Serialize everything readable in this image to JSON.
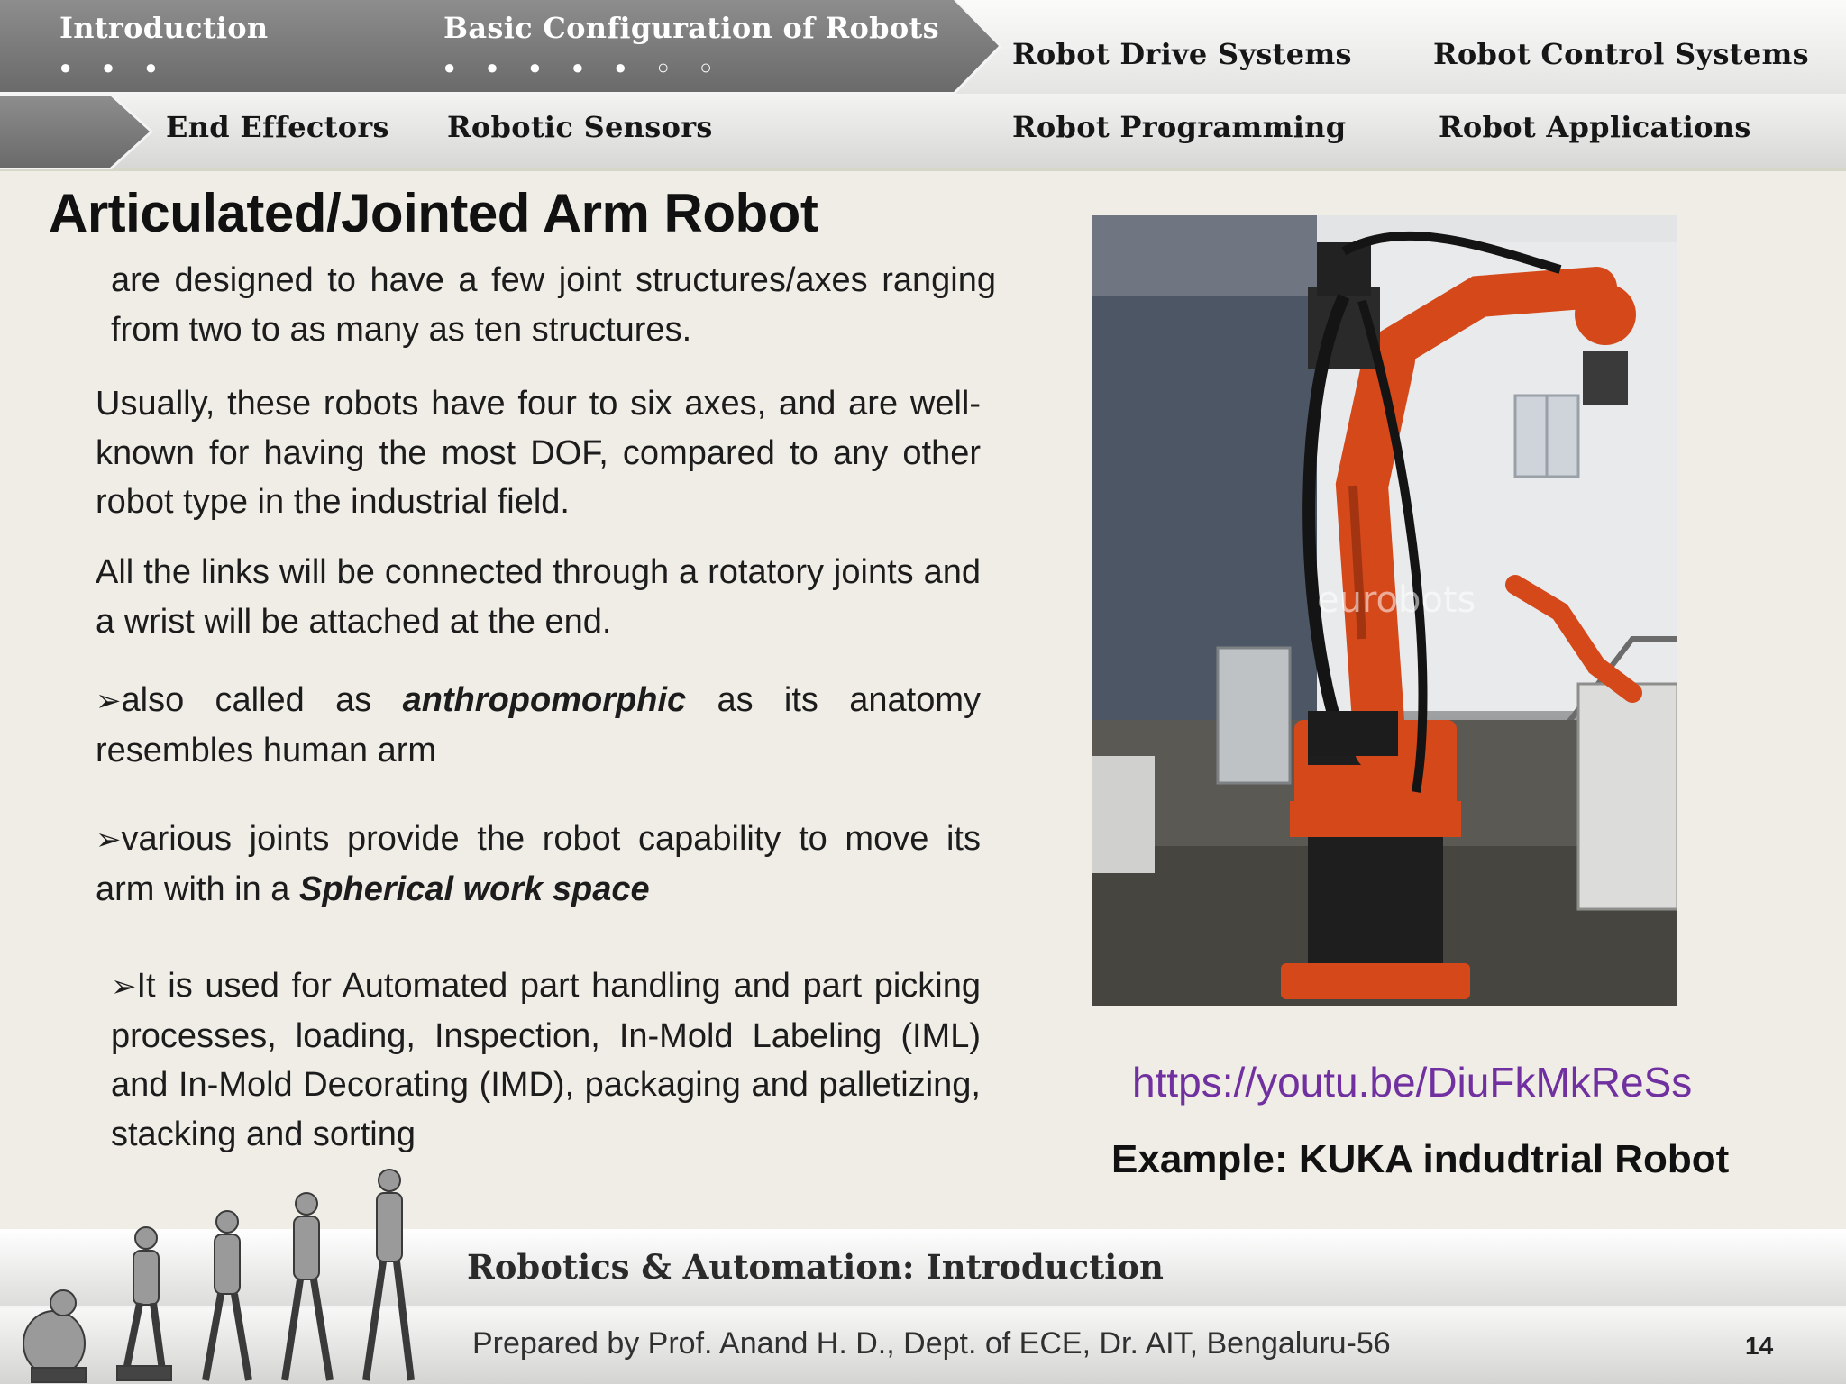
{
  "nav": {
    "top_row": [
      {
        "label": "Introduction",
        "progress_dots": "● ● ●"
      },
      {
        "label": "Basic Configuration of Robots",
        "progress_dots": "● ● ● ● ● ○ ○"
      },
      {
        "label": "Robot Drive Systems"
      },
      {
        "label": "Robot Control Systems"
      }
    ],
    "bottom_row": [
      {
        "label": "End Effectors"
      },
      {
        "label": "Robotic Sensors"
      },
      {
        "label": "Robot Programming"
      },
      {
        "label": "Robot Applications"
      }
    ]
  },
  "slide": {
    "title": "Articulated/Jointed Arm Robot",
    "paragraphs": [
      "are designed to have a few joint structures/axes ranging from two to as many as ten structures.",
      "Usually, these robots have four to six axes, and are well-known for having the most DOF, compared to any other robot type in the industrial field.",
      "All the links will be connected through a rotatory joints and a wrist will be attached at the end."
    ],
    "bullet_symbol": "➢",
    "bullets": [
      {
        "before": "also called as ",
        "emphasis": "anthropomorphic",
        "after": " as its anatomy resembles human arm"
      },
      {
        "before": "various joints provide the robot capability to move its arm with in a ",
        "emphasis": "Spherical work space",
        "after": ""
      },
      {
        "text": "It is used for Automated part handling and part picking processes, loading, Inspection, In-Mold Labeling (IML) and In-Mold Decorating (IMD), packaging and palletizing, stacking and sorting"
      }
    ],
    "image_watermark": "eurobots",
    "video_link": "https://youtu.be/DiuFkMkReSs",
    "caption": "Example: KUKA  indudtrial Robot"
  },
  "footer": {
    "course_title": "Robotics & Automation: Introduction",
    "credit": "Prepared by Prof. Anand H. D., Dept. of ECE,  Dr. AIT, Bengaluru-56",
    "page_number": "14"
  },
  "colors": {
    "link": "#7030a0",
    "robot_orange": "#d4481a",
    "nav_arrow": "#7a7a7a",
    "background": "#efede6"
  }
}
